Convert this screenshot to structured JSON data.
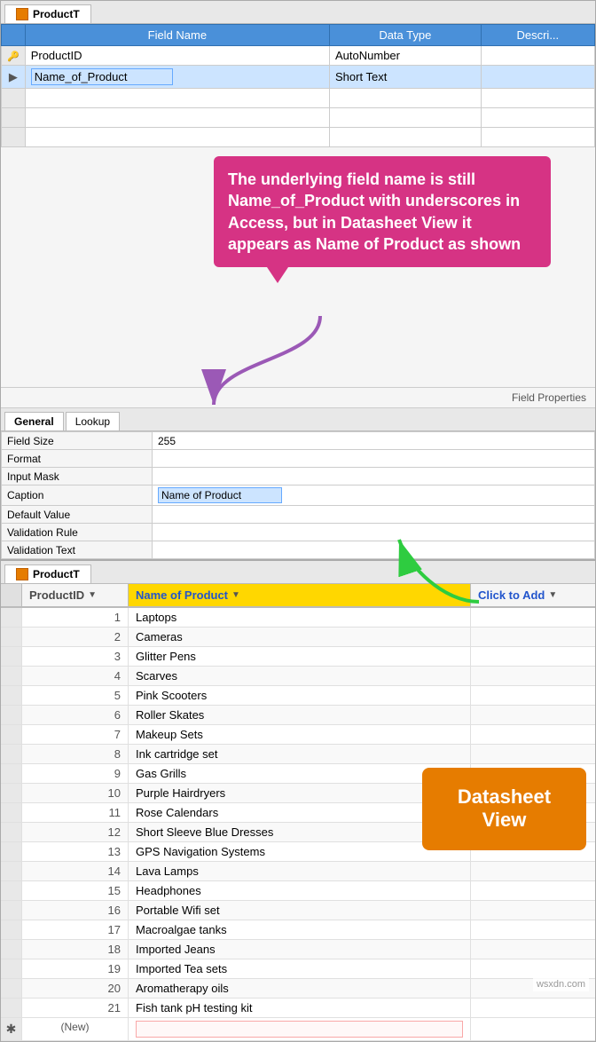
{
  "designView": {
    "tabLabel": "ProductT",
    "tableHeaders": [
      "Field Name",
      "Data Type",
      "Descri..."
    ],
    "rows": [
      {
        "key": true,
        "fieldName": "ProductID",
        "dataType": "AutoNumber"
      },
      {
        "key": false,
        "fieldName": "Name_of_Product",
        "dataType": "Short Text",
        "selected": true
      }
    ],
    "callout": {
      "text": "The underlying field name is still Name_of_Product with underscores in Access, but in Datasheet View it appears as Name of Product as shown"
    },
    "fieldPropsLabel": "Field Properties",
    "propsTabs": [
      "General",
      "Lookup"
    ],
    "activeTab": "General",
    "properties": [
      {
        "label": "Field Size",
        "value": "255"
      },
      {
        "label": "Format",
        "value": ""
      },
      {
        "label": "Input Mask",
        "value": ""
      },
      {
        "label": "Caption",
        "value": "Name of Product",
        "isInput": true
      },
      {
        "label": "Default Value",
        "value": ""
      },
      {
        "label": "Validation Rule",
        "value": ""
      },
      {
        "label": "Validation Text",
        "value": ""
      }
    ]
  },
  "datasheetView": {
    "tabLabel": "ProductT",
    "columns": {
      "id": "ProductID",
      "name": "Name of Product",
      "add": "Click to Add"
    },
    "rows": [
      {
        "id": 1,
        "name": "Laptops"
      },
      {
        "id": 2,
        "name": "Cameras"
      },
      {
        "id": 3,
        "name": "Glitter Pens"
      },
      {
        "id": 4,
        "name": "Scarves"
      },
      {
        "id": 5,
        "name": "Pink Scooters"
      },
      {
        "id": 6,
        "name": "Roller Skates"
      },
      {
        "id": 7,
        "name": "Makeup Sets"
      },
      {
        "id": 8,
        "name": "Ink cartridge set"
      },
      {
        "id": 9,
        "name": "Gas Grills"
      },
      {
        "id": 10,
        "name": "Purple Hairdryers"
      },
      {
        "id": 11,
        "name": "Rose Calendars"
      },
      {
        "id": 12,
        "name": "Short Sleeve Blue Dresses"
      },
      {
        "id": 13,
        "name": "GPS Navigation Systems"
      },
      {
        "id": 14,
        "name": "Lava Lamps"
      },
      {
        "id": 15,
        "name": "Headphones"
      },
      {
        "id": 16,
        "name": "Portable Wifi set"
      },
      {
        "id": 17,
        "name": "Macroalgae tanks"
      },
      {
        "id": 18,
        "name": "Imported Jeans"
      },
      {
        "id": 19,
        "name": "Imported Tea sets"
      },
      {
        "id": 20,
        "name": "Aromatherapy oils"
      },
      {
        "id": 21,
        "name": "Fish tank pH testing kit"
      }
    ],
    "newRowLabel": "(New)",
    "calloutText": "Datasheet View"
  },
  "watermark": "wsxdn.com"
}
